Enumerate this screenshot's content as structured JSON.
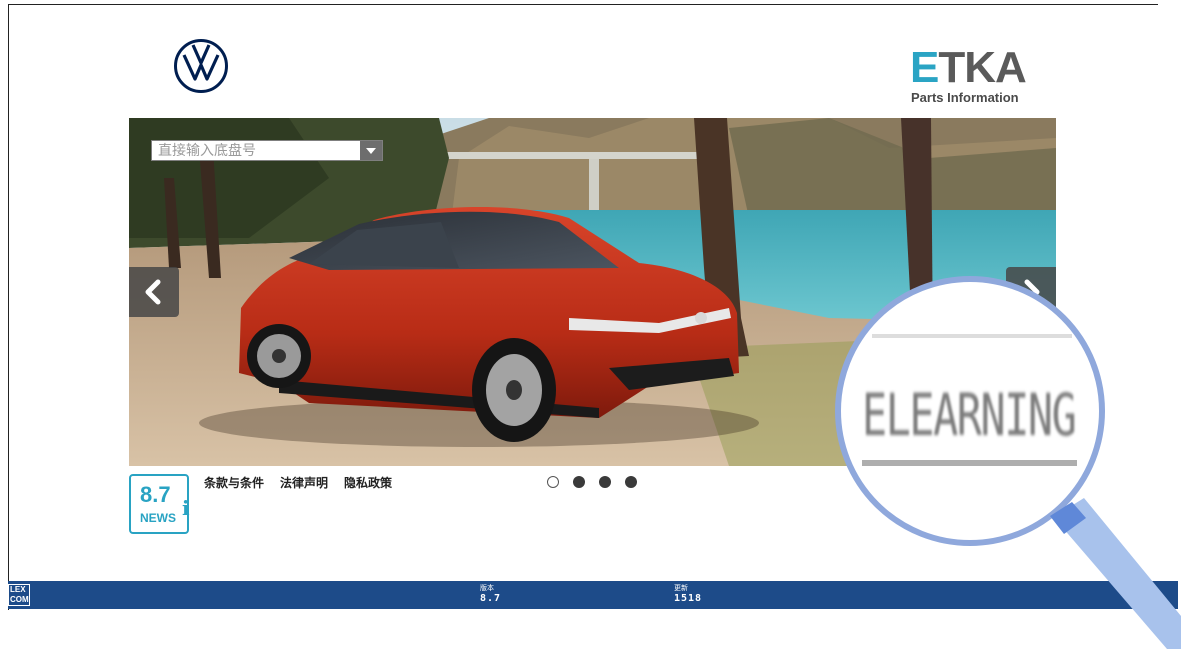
{
  "header": {
    "brand_icon": "vw-logo-icon",
    "etka": {
      "word": "TKA",
      "letter": "E",
      "subtitle": "Parts Information"
    }
  },
  "search": {
    "placeholder": "直接输入底盘号",
    "value": ""
  },
  "carousel": {
    "prev_icon": "chevron-left-icon",
    "next_icon": "chevron-right-icon",
    "slide_count": 4,
    "active_index": 0
  },
  "footer": {
    "links": [
      "条款与条件",
      "法律声明",
      "隐私政策"
    ],
    "news": {
      "version": "8.7",
      "label": "NEWS",
      "info_glyph": "i"
    }
  },
  "status_bar": {
    "logo_top": "LEX",
    "logo_bottom": "COM",
    "version_label": "版本",
    "version_value": "8.7",
    "update_label": "更新",
    "update_value": "1518",
    "background": "#1d4b89"
  },
  "magnifier": {
    "text": "ELEARNING"
  },
  "colors": {
    "accent": "#29a3c3",
    "brand_dark": "#001e50"
  }
}
